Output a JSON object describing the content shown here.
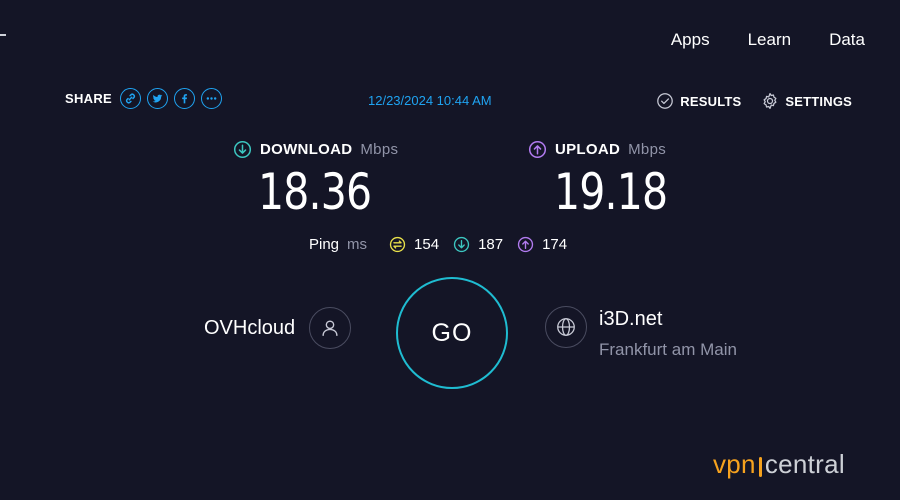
{
  "nav": {
    "apps": "Apps",
    "learn": "Learn",
    "data": "Data"
  },
  "share": {
    "label": "SHARE",
    "icons": [
      "link-icon",
      "twitter-icon",
      "facebook-icon",
      "more-icon"
    ]
  },
  "timestamp": "12/23/2024 10:44 AM",
  "links": {
    "results": "RESULTS",
    "settings": "SETTINGS"
  },
  "download": {
    "label": "DOWNLOAD",
    "unit": "Mbps",
    "value": "18.36"
  },
  "upload": {
    "label": "UPLOAD",
    "unit": "Mbps",
    "value": "19.18"
  },
  "ping": {
    "label": "Ping",
    "unit": "ms",
    "idle": "154",
    "download": "187",
    "upload": "174"
  },
  "go": "GO",
  "isp": {
    "name": "OVHcloud"
  },
  "server": {
    "name": "i3D.net",
    "location": "Frankfurt am Main"
  },
  "brand": {
    "part1": "vpn",
    "part2": "central"
  },
  "colors": {
    "background": "#141526",
    "accent_blue": "#1fa3f1",
    "download": "#3cc6c0",
    "upload": "#b27bf0",
    "idle_ping": "#e8e04a",
    "go_ring": "#1fbcd1",
    "brand_orange": "#f6a21e"
  }
}
